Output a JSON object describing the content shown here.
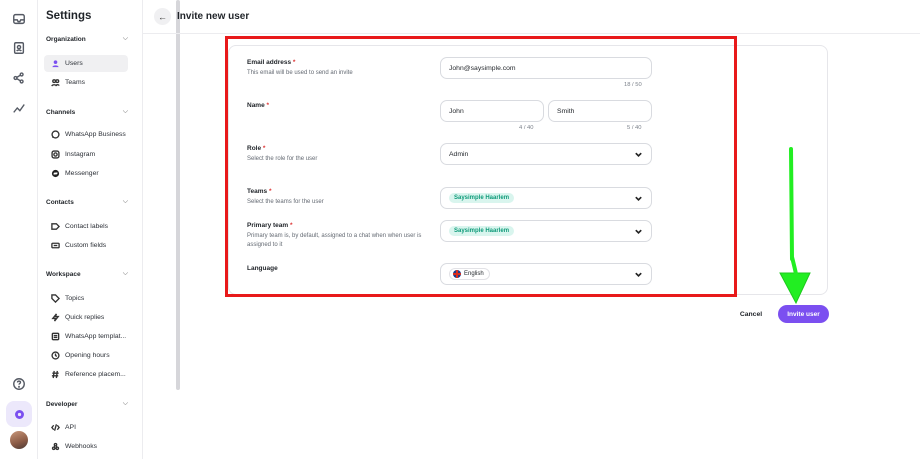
{
  "header": {
    "title": "Invite new user"
  },
  "sidebar": {
    "title": "Settings",
    "sections": [
      {
        "label": "Organization",
        "items": [
          "Users",
          "Teams"
        ]
      },
      {
        "label": "Channels",
        "items": [
          "WhatsApp Business",
          "Instagram",
          "Messenger"
        ]
      },
      {
        "label": "Contacts",
        "items": [
          "Contact labels",
          "Custom fields"
        ]
      },
      {
        "label": "Workspace",
        "items": [
          "Topics",
          "Quick replies",
          "WhatsApp templat...",
          "Opening hours",
          "Reference placem..."
        ]
      },
      {
        "label": "Developer",
        "items": [
          "API",
          "Webhooks"
        ]
      }
    ],
    "active_item": "Users"
  },
  "form": {
    "email": {
      "label": "Email address",
      "required": "*",
      "help": "This email will be used to send an invite",
      "value": "John@saysimple.com",
      "counter": "18 / 50"
    },
    "name": {
      "label": "Name",
      "required": "*",
      "first": "John",
      "last": "Smith",
      "first_counter": "4 / 40",
      "last_counter": "5 / 40"
    },
    "role": {
      "label": "Role",
      "required": "*",
      "help": "Select the role for the user",
      "value": "Admin"
    },
    "teams": {
      "label": "Teams",
      "required": "*",
      "help": "Select the teams for the user",
      "value": "Saysimple Haarlem"
    },
    "primary_team": {
      "label": "Primary team",
      "required": "*",
      "help": "Primary team is, by default, assigned to a chat when when user is assigned to it",
      "value": "Saysimple Haarlem"
    },
    "language": {
      "label": "Language",
      "value": "English"
    }
  },
  "actions": {
    "cancel": "Cancel",
    "invite": "Invite user"
  },
  "colors": {
    "accent": "#7b4ff0",
    "chip_text": "#0f9b7a",
    "highlight": "#e8191a",
    "arrow": "#22ee22"
  }
}
